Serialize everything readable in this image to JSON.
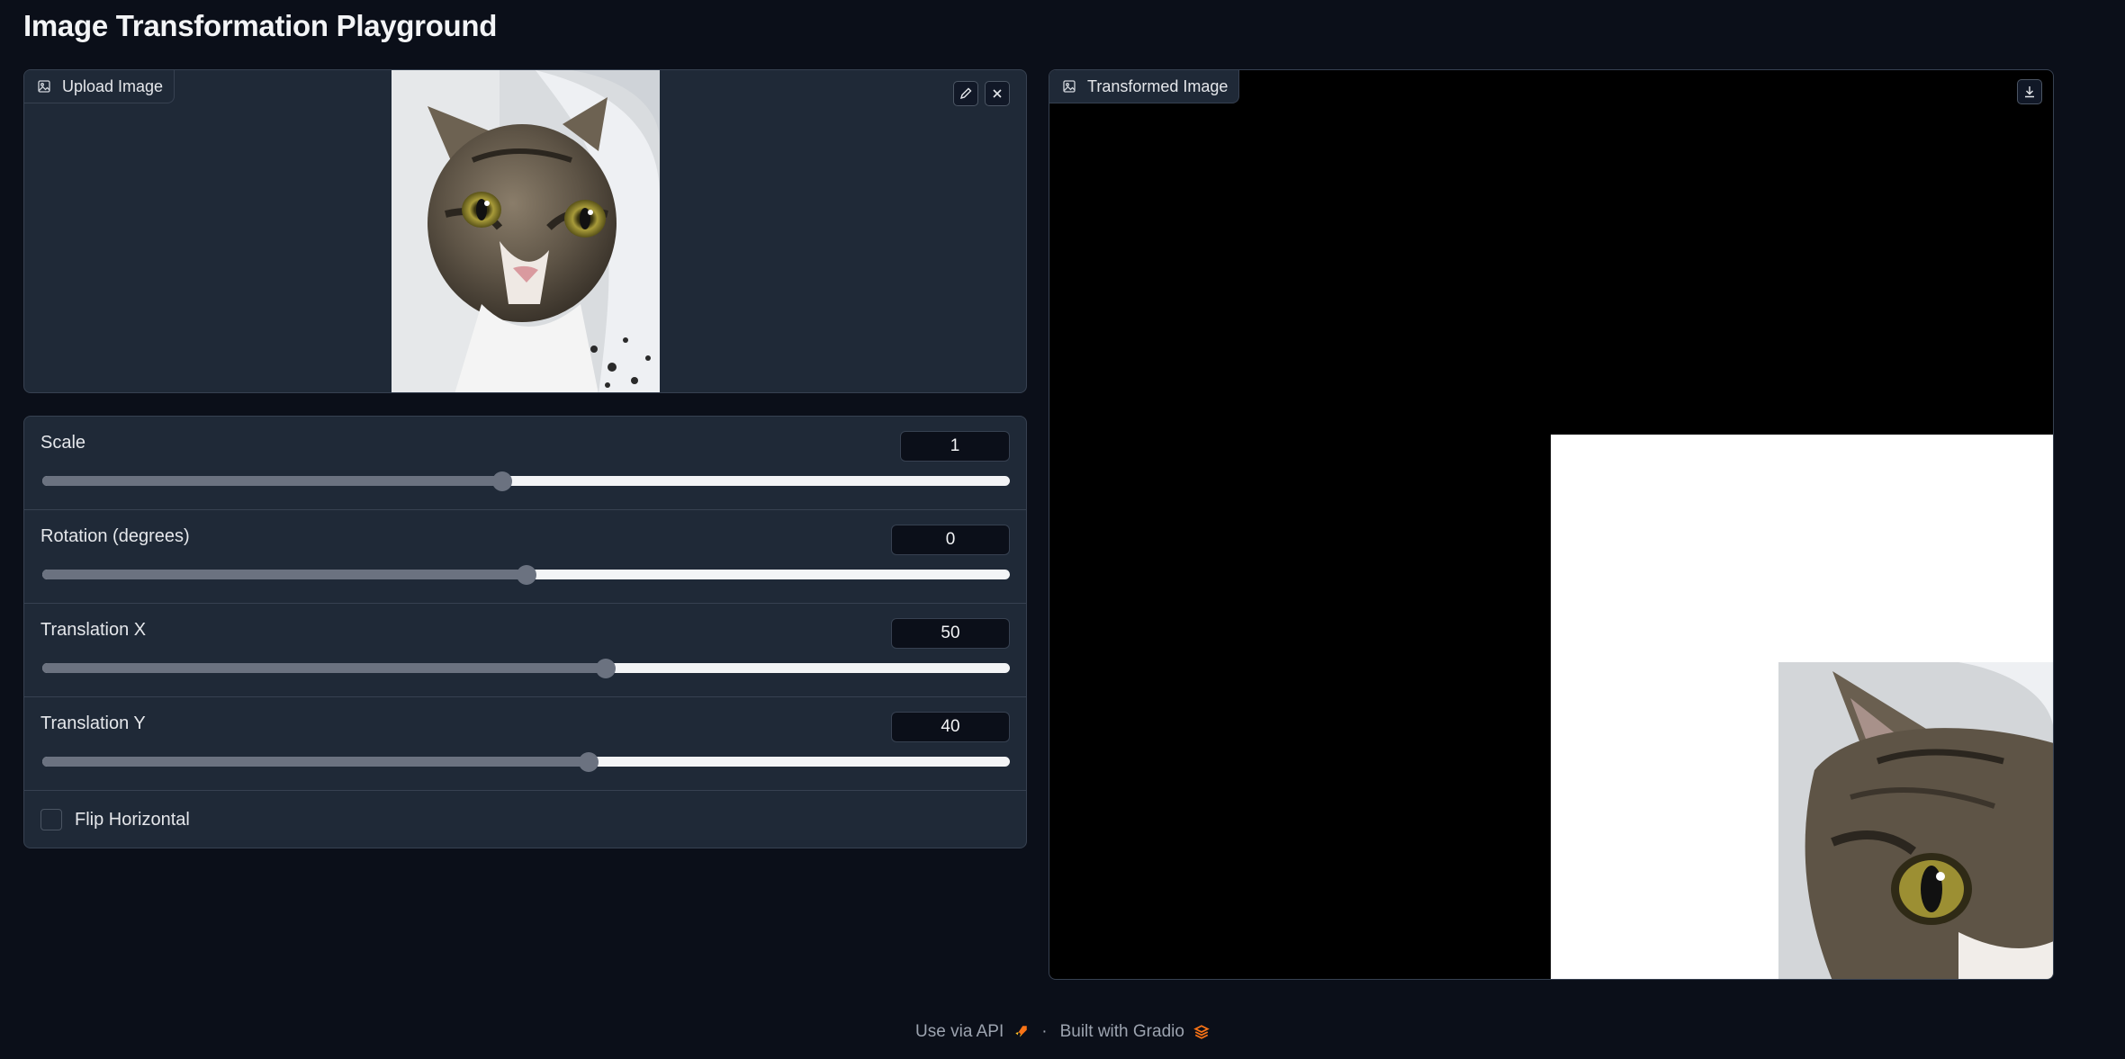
{
  "page": {
    "title": "Image Transformation Playground"
  },
  "upload": {
    "label": "Upload Image",
    "label_icon": "image-icon",
    "edit_icon": "pencil-icon",
    "clear_icon": "close-icon"
  },
  "controls": {
    "scale": {
      "label": "Scale",
      "value": "1",
      "fraction": 0.475
    },
    "rotation": {
      "label": "Rotation (degrees)",
      "value": "0",
      "fraction": 0.5
    },
    "translation_x": {
      "label": "Translation X",
      "value": "50",
      "fraction": 0.582
    },
    "translation_y": {
      "label": "Translation Y",
      "value": "40",
      "fraction": 0.565
    },
    "flip_horizontal": {
      "label": "Flip Horizontal",
      "checked": false
    }
  },
  "output": {
    "label": "Transformed Image",
    "label_icon": "image-icon",
    "download_icon": "download-icon"
  },
  "footer": {
    "api_label": "Use via API",
    "separator": "·",
    "built_label": "Built with Gradio"
  },
  "colors": {
    "background": "#0b0f19",
    "panel": "#1f2937",
    "border": "#374151",
    "track_filled": "#6b7280",
    "track_empty": "#f3f4f6",
    "gradio_orange": "#f97316"
  }
}
